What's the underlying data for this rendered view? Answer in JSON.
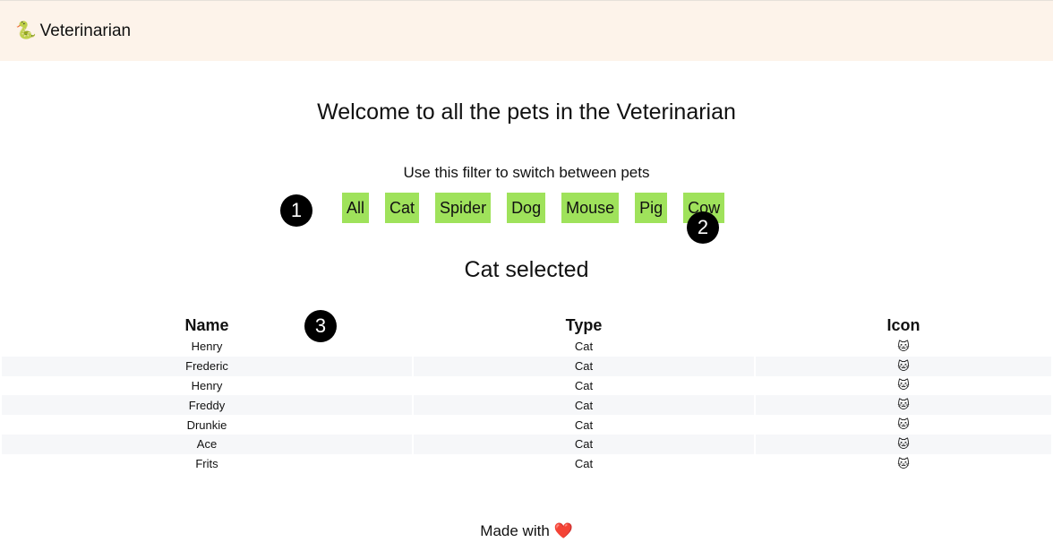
{
  "header": {
    "icon": "🐍",
    "icon_name": "snake-icon",
    "title": "Veterinarian"
  },
  "main": {
    "title": "Welcome to all the pets in the Veterinarian",
    "filter_label": "Use this filter to switch between pets",
    "filters": [
      "All",
      "Cat",
      "Spider",
      "Dog",
      "Mouse",
      "Pig",
      "Cow"
    ],
    "filter_color": "#9fe25b",
    "selected_text": "Cat selected"
  },
  "markers": [
    "1",
    "2",
    "3"
  ],
  "table": {
    "headers": [
      "Name",
      "Type",
      "Icon"
    ],
    "rows": [
      {
        "name": "Henry",
        "type": "Cat",
        "icon": "🐱"
      },
      {
        "name": "Frederic",
        "type": "Cat",
        "icon": "🐱"
      },
      {
        "name": "Henry",
        "type": "Cat",
        "icon": "🐱"
      },
      {
        "name": "Freddy",
        "type": "Cat",
        "icon": "🐱"
      },
      {
        "name": "Drunkie",
        "type": "Cat",
        "icon": "🐱"
      },
      {
        "name": "Ace",
        "type": "Cat",
        "icon": "🐱"
      },
      {
        "name": "Frits",
        "type": "Cat",
        "icon": "🐱"
      }
    ]
  },
  "footer": {
    "text": "Made with",
    "heart": "❤️"
  }
}
